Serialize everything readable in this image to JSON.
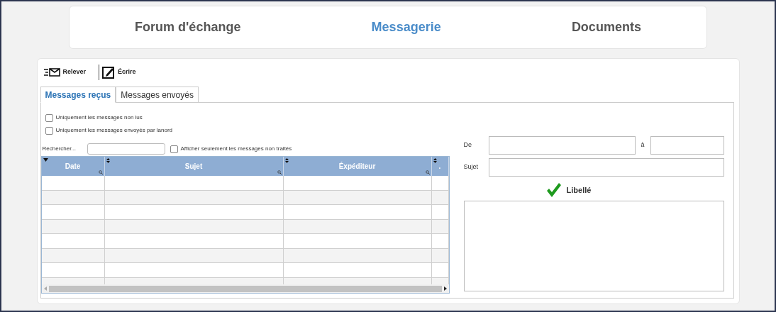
{
  "nav": [
    {
      "label": "Forum d'échange",
      "selected": false
    },
    {
      "label": "Messagerie",
      "selected": true
    },
    {
      "label": "Documents",
      "selected": false
    }
  ],
  "toolbar": [
    {
      "label": "Relever",
      "kind": "fetch"
    },
    {
      "label": "Écrire",
      "kind": "compose"
    }
  ],
  "tabs": [
    {
      "label": "Messages reçus",
      "selected": true
    },
    {
      "label": "Messages envoyés",
      "selected": false
    }
  ],
  "filters": [
    {
      "label": "Uniquement les messages non lus",
      "checked": false
    },
    {
      "label": "Uniquement les messages envoyés par lanord",
      "checked": false
    }
  ],
  "search": {
    "label": "Rechercher...",
    "option": {
      "label": "Afficher seulement les messages non traités",
      "checked": false
    }
  },
  "table": {
    "columns": [
      {
        "label": "Date",
        "sorted": true
      },
      {
        "label": "Sujet",
        "sorted": false
      },
      {
        "label": "Éxpéditeur",
        "sorted": false
      },
      {
        "label": ".",
        "sorted": false
      }
    ]
  },
  "detail": {
    "from_label": "De",
    "to_label": "à",
    "subject_label": "Sujet",
    "label_heading": "Libellé"
  }
}
